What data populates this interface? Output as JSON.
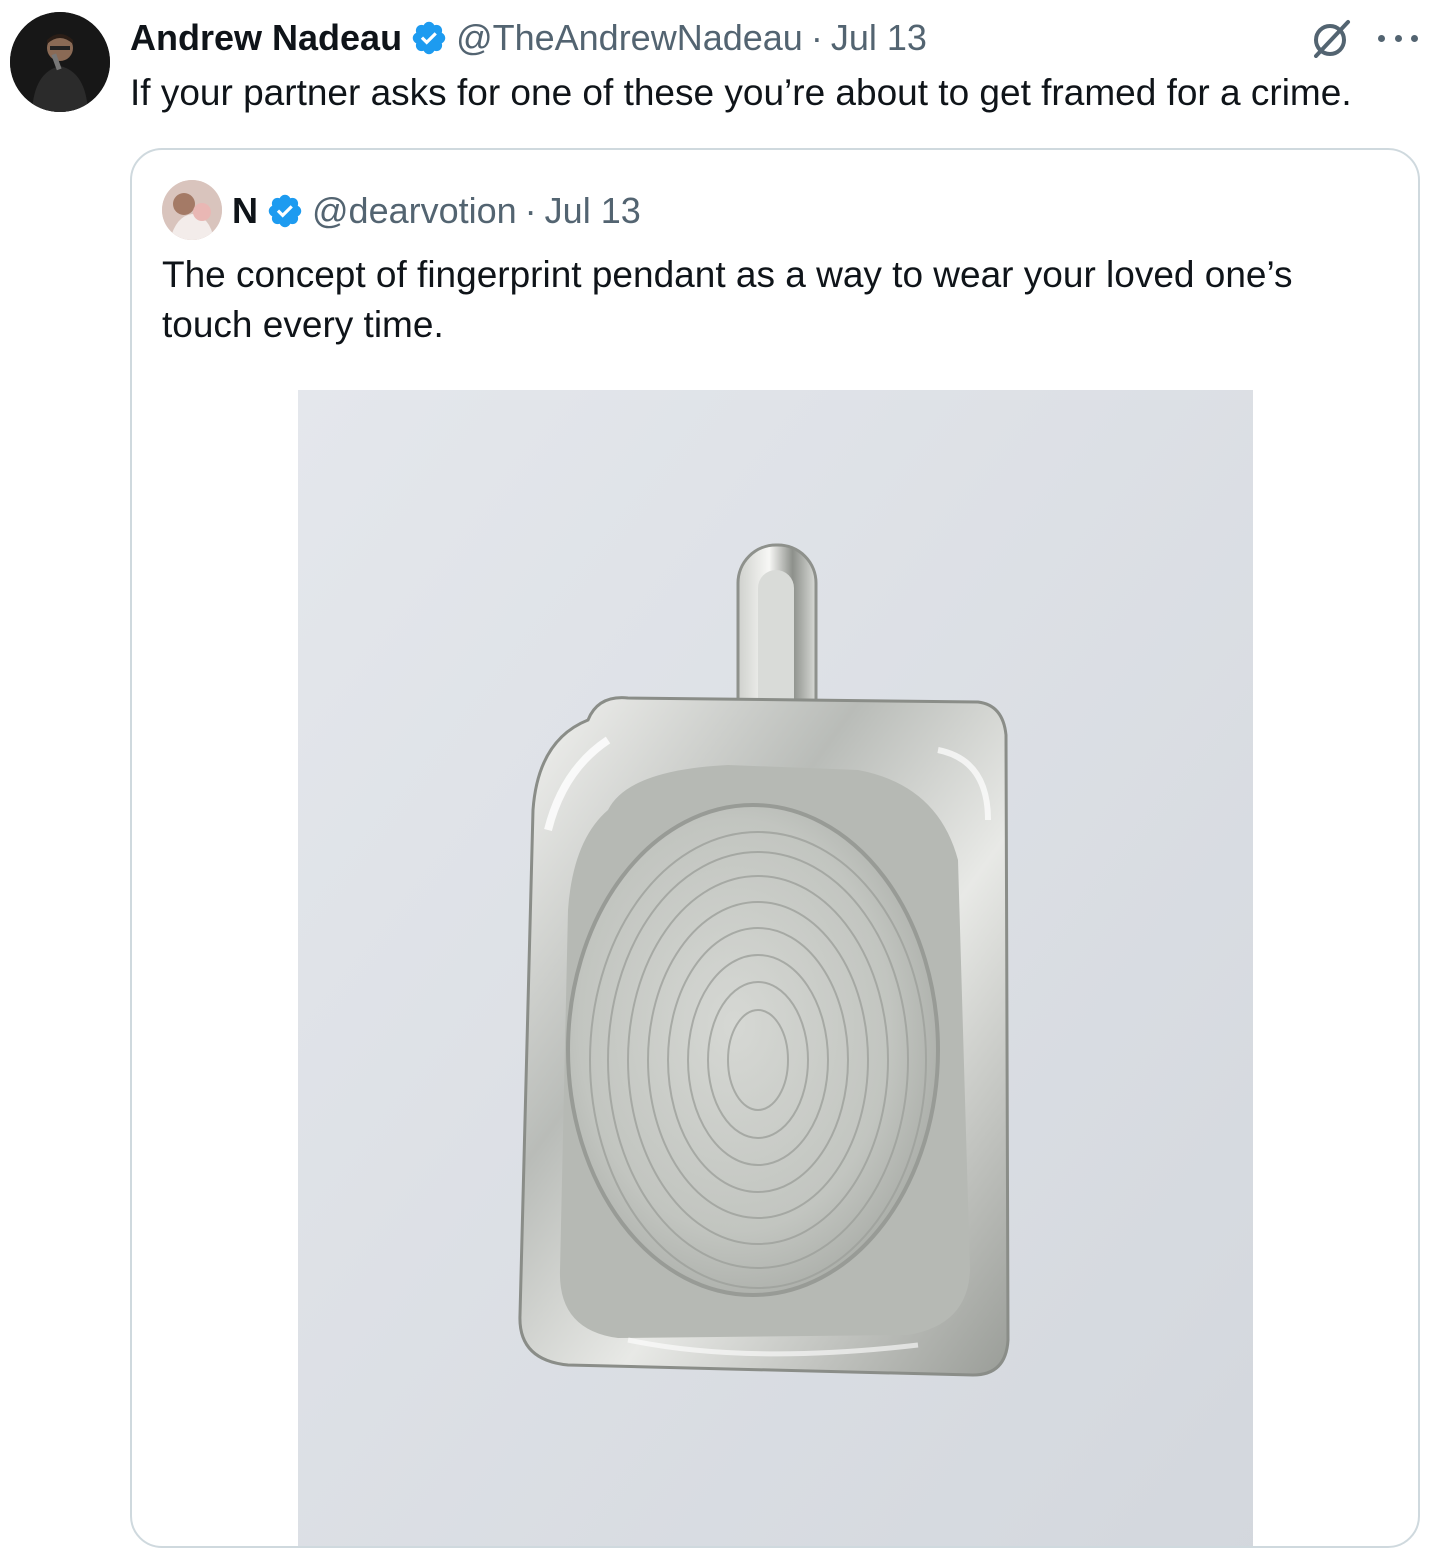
{
  "tweet": {
    "author_name": "Andrew Nadeau",
    "handle": "@TheAndrewNadeau",
    "separator": "·",
    "date": "Jul 13",
    "text": "If your partner asks for one of these you’re about to get framed for a crime."
  },
  "quoted_tweet": {
    "author_name": "N",
    "handle": "@dearvotion",
    "separator": "·",
    "date": "Jul 13",
    "text": "The concept of fingerprint pendant as a way to wear your loved one’s touch every time."
  },
  "colors": {
    "verified_badge": "#1d9bf0",
    "secondary_text": "#536471",
    "card_border": "#cfd9de"
  },
  "icons": {
    "verified": "verified-badge-icon",
    "grok": "grok-icon",
    "more": "more-options-icon"
  }
}
